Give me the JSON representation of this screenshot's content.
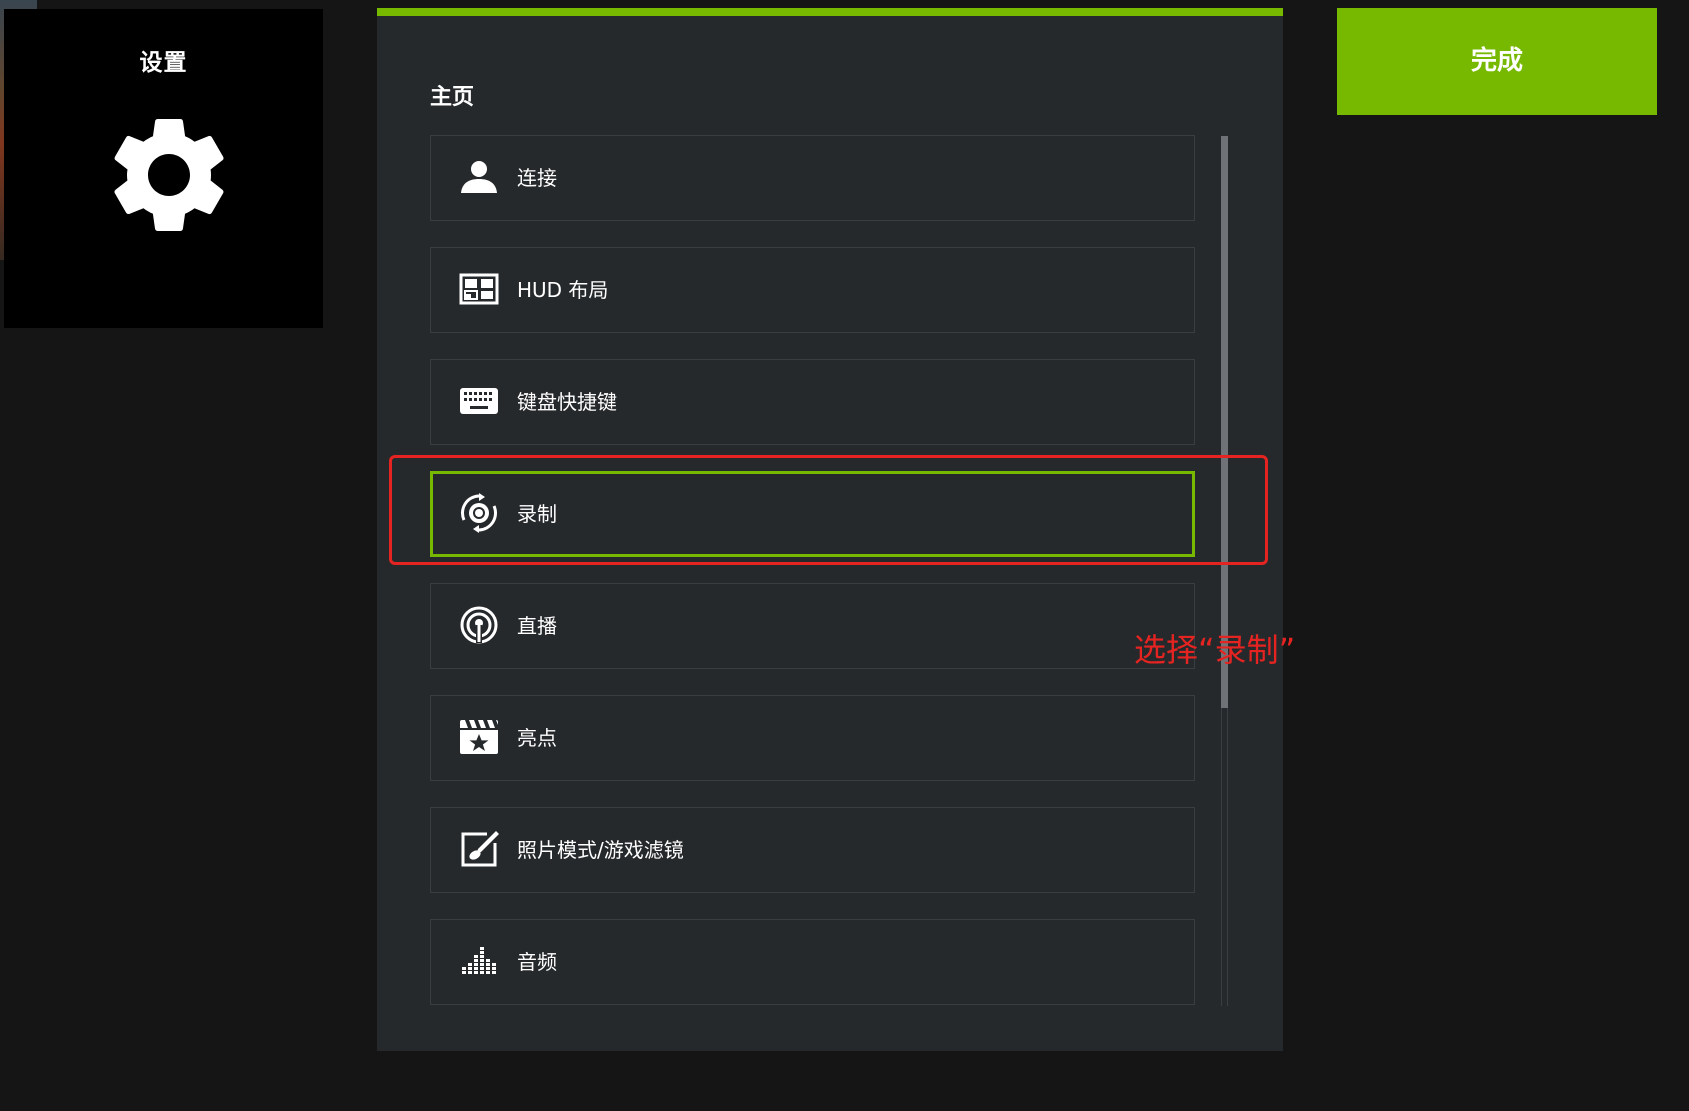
{
  "settings_tile": {
    "title": "设置",
    "icon": "gear-icon"
  },
  "panel": {
    "heading": "主页",
    "accent_color": "#76b900",
    "items": [
      {
        "label": "连接",
        "icon": "user-icon",
        "selected": false
      },
      {
        "label": "HUD 布局",
        "icon": "hud-layout-icon",
        "selected": false
      },
      {
        "label": "键盘快捷键",
        "icon": "keyboard-icon",
        "selected": false
      },
      {
        "label": "录制",
        "icon": "record-icon",
        "selected": true
      },
      {
        "label": "直播",
        "icon": "broadcast-icon",
        "selected": false
      },
      {
        "label": "亮点",
        "icon": "clapperboard-star-icon",
        "selected": false
      },
      {
        "label": "照片模式/游戏滤镜",
        "icon": "photo-mode-icon",
        "selected": false
      },
      {
        "label": "音频",
        "icon": "audio-equalizer-icon",
        "selected": false
      }
    ]
  },
  "done_button": {
    "label": "完成",
    "color": "#76b900"
  },
  "annotation": {
    "text": "选择“录制”",
    "color": "#e52421"
  }
}
